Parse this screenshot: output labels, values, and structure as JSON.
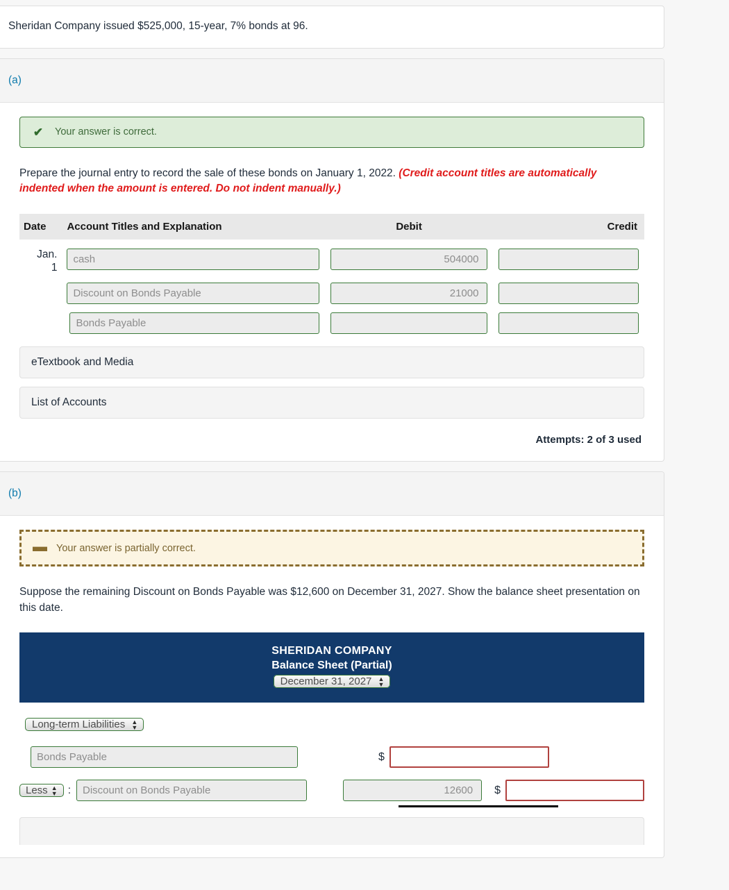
{
  "problem": {
    "statement": "Sheridan Company issued $525,000, 15-year, 7% bonds at 96."
  },
  "part_a": {
    "label": "(a)",
    "status": {
      "icon": "check-icon",
      "glyph": "✔",
      "text": "Your answer is correct.",
      "color": "#3f6b3b"
    },
    "instructions_plain": "Prepare the journal entry to record the sale of these bonds on January 1, 2022. ",
    "instructions_emphasis": "(Credit account titles are automatically indented when the amount is entered. Do not indent manually.)",
    "table": {
      "headers": {
        "date": "Date",
        "account": "Account Titles and Explanation",
        "debit": "Debit",
        "credit": "Credit"
      },
      "rows": [
        {
          "date_line1": "Jan.",
          "date_line2": "1",
          "account": "cash",
          "debit": "504000",
          "credit": "",
          "indent": false
        },
        {
          "date_line1": "",
          "date_line2": "",
          "account": "Discount on Bonds Payable",
          "debit": "21000",
          "credit": "",
          "indent": false
        },
        {
          "date_line1": "",
          "date_line2": "",
          "account": "Bonds Payable",
          "debit": "",
          "credit": "",
          "indent": true
        }
      ]
    },
    "etextbook_button": "eTextbook and Media",
    "list_of_accounts_button": "List of Accounts",
    "attempts": "Attempts: 2 of 3 used"
  },
  "part_b": {
    "label": "(b)",
    "status": {
      "icon": "minus-icon",
      "glyph": "➖",
      "text": "Your answer is partially correct.",
      "color": "#7a6430"
    },
    "instructions": "Suppose the remaining Discount on Bonds Payable was $12,600 on December 31, 2027. Show the balance sheet presentation on this date.",
    "balance_sheet": {
      "company": "SHERIDAN COMPANY",
      "title": "Balance Sheet (Partial)",
      "date_select_value": "December 31, 2027",
      "group_select_value": "Long-term Liabilities",
      "rows": [
        {
          "account": "Bonds Payable",
          "amount": "",
          "dollar_sign": "$",
          "total": "",
          "total_error": true
        },
        {
          "modifier_select_value": "Less",
          "colon": ":",
          "account": "Discount on Bonds Payable",
          "amount": "12600",
          "dollar_sign": "$",
          "total": "",
          "total_error": true
        }
      ]
    }
  },
  "theme": {
    "accent_blue": "#0e7bad",
    "banner_green_bg": "#ddedd9",
    "banner_green_border": "#3f7a39",
    "banner_yellow_bg": "#fcf5e3",
    "banner_yellow_border": "#8a6d2f",
    "input_green_border": "#3a7a38",
    "input_error_border": "#b0413e",
    "bs_header_bg": "#123a6b",
    "emphasis_red": "#e01b1b"
  }
}
